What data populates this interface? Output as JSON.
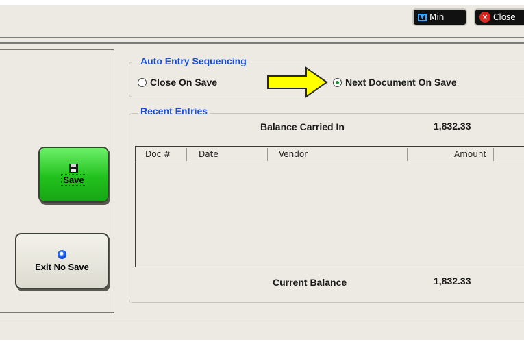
{
  "toolbar": {
    "min_label": "Min",
    "close_label": "Close"
  },
  "actions": {
    "save_label": "Save",
    "exit_label": "Exit No Save"
  },
  "auto_entry": {
    "title": "Auto Entry Sequencing",
    "options": [
      {
        "label": "Close On Save",
        "selected": false
      },
      {
        "label": "Next Document On Save",
        "selected": true
      }
    ]
  },
  "recent_entries": {
    "title": "Recent Entries",
    "balance_in_label": "Balance Carried In",
    "balance_in_value": "1,832.33",
    "columns": [
      "Doc #",
      "Date",
      "Vendor",
      "Amount"
    ],
    "rows": [],
    "current_balance_label": "Current Balance",
    "current_balance_value": "1,832.33"
  },
  "colors": {
    "group_title": "#1a4fd1",
    "save_green": "#21c11d",
    "arrow_yellow": "#ffff00"
  }
}
